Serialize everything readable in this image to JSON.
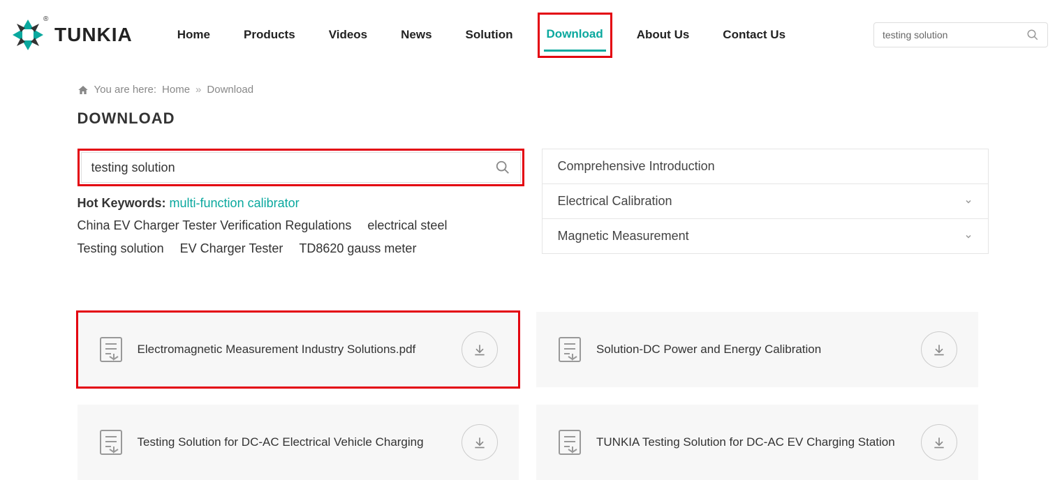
{
  "header": {
    "logo_text": "TUNKIA",
    "nav": [
      "Home",
      "Products",
      "Videos",
      "News",
      "Solution",
      "Download",
      "About Us",
      "Contact Us"
    ],
    "active_index": 5,
    "search_value": "testing solution"
  },
  "breadcrumb": {
    "prefix": "You are here:",
    "items": [
      "Home",
      "Download"
    ],
    "separator": "»"
  },
  "page_title": "DOWNLOAD",
  "main_search": {
    "value": "testing solution"
  },
  "hot_keywords": {
    "label": "Hot Keywords:",
    "items": [
      {
        "text": "multi-function calibrator",
        "highlight": true
      },
      {
        "text": "China EV Charger Tester Verification Regulations",
        "highlight": false
      },
      {
        "text": "electrical steel",
        "highlight": false
      },
      {
        "text": "Testing solution",
        "highlight": false
      },
      {
        "text": "EV Charger Tester",
        "highlight": false
      },
      {
        "text": "TD8620 gauss meter",
        "highlight": false
      }
    ]
  },
  "categories": [
    {
      "label": "Comprehensive Introduction",
      "expandable": false
    },
    {
      "label": "Electrical Calibration",
      "expandable": true
    },
    {
      "label": "Magnetic Measurement",
      "expandable": true
    }
  ],
  "downloads": [
    {
      "title": "Electromagnetic Measurement Industry Solutions.pdf",
      "highlighted": true
    },
    {
      "title": "Solution-DC Power and Energy Calibration",
      "highlighted": false
    },
    {
      "title": "Testing Solution for DC-AC Electrical Vehicle Charging",
      "highlighted": false
    },
    {
      "title": "TUNKIA Testing Solution for DC-AC EV Charging Station",
      "highlighted": false
    }
  ]
}
